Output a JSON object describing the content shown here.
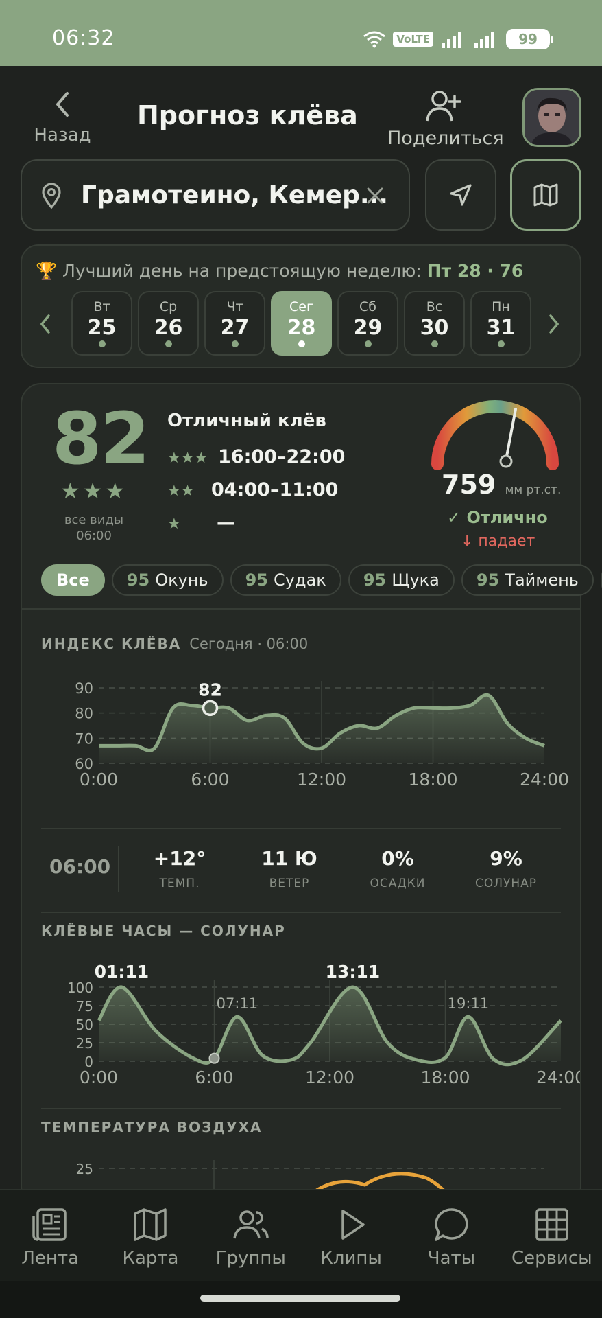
{
  "status": {
    "time": "06:32",
    "volte": "VoLTE",
    "battery": "99"
  },
  "header": {
    "back_label": "Назад",
    "title": "Прогноз клёва",
    "share_label": "Поделиться"
  },
  "search": {
    "location": "Грамотеино, Кемер..."
  },
  "best_day": {
    "prefix": "🏆 Лучший день на предстоящую неделю:",
    "value": "Пт 28 · 76"
  },
  "days": [
    {
      "wd": "Вт",
      "num": "25"
    },
    {
      "wd": "Ср",
      "num": "26"
    },
    {
      "wd": "Чт",
      "num": "27"
    },
    {
      "wd": "Сег",
      "num": "28"
    },
    {
      "wd": "Сб",
      "num": "29"
    },
    {
      "wd": "Вс",
      "num": "30"
    },
    {
      "wd": "Пн",
      "num": "31"
    }
  ],
  "selected_day_index": 3,
  "forecast": {
    "score": "82",
    "stars": "★★★",
    "species_label": "все виды",
    "time": "06:00",
    "quality": "Отличный клёв",
    "periods": [
      {
        "stars": "★★★",
        "range": "16:00–22:00"
      },
      {
        "stars": "★★",
        "range": "04:00–11:00"
      },
      {
        "stars": "★",
        "range": "—"
      }
    ],
    "pressure_value": "759",
    "pressure_unit": "мм рт.ст.",
    "pressure_status": "✓ Отлично",
    "pressure_trend": "↓ падает"
  },
  "chips": [
    {
      "score": "",
      "name": "Все",
      "active": true
    },
    {
      "score": "95",
      "name": "Окунь"
    },
    {
      "score": "95",
      "name": "Судак"
    },
    {
      "score": "95",
      "name": "Щука"
    },
    {
      "score": "95",
      "name": "Таймень"
    }
  ],
  "bite_index": {
    "title": "ИНДЕКС КЛЁВА",
    "subtitle": "Сегодня · 06:00",
    "marker_label": "82"
  },
  "weather": {
    "time": "06:00",
    "cols": [
      {
        "value": "+12°",
        "label": "ТЕМП."
      },
      {
        "value": "11 Ю",
        "label": "ВЕТЕР"
      },
      {
        "value": "0%",
        "label": "ОСАДКИ"
      },
      {
        "value": "9%",
        "label": "СОЛУНАР"
      }
    ]
  },
  "solunar": {
    "title": "КЛЁВЫЕ ЧАСЫ — СОЛУНАР",
    "labels": [
      {
        "text": "01:11",
        "major": true
      },
      {
        "text": "07:11",
        "major": false
      },
      {
        "text": "13:11",
        "major": true
      },
      {
        "text": "19:11",
        "major": false
      }
    ]
  },
  "temperature": {
    "title": "ТЕМПЕРАТУРА ВОЗДУХА"
  },
  "chart_data": [
    {
      "type": "area",
      "title": "ИНДЕКС КЛЁВА",
      "x": [
        0,
        1,
        2,
        3,
        4,
        5,
        6,
        7,
        8,
        9,
        10,
        11,
        12,
        13,
        14,
        15,
        16,
        17,
        18,
        19,
        20,
        21,
        22,
        23,
        24
      ],
      "values": [
        67,
        67,
        67,
        66,
        82,
        83,
        82,
        82,
        77,
        79,
        78,
        68,
        66,
        72,
        75,
        74,
        79,
        82,
        82,
        82,
        83,
        87,
        76,
        70,
        67
      ],
      "xticks": [
        "0:00",
        "6:00",
        "12:00",
        "18:00",
        "24:00"
      ],
      "yticks": [
        60,
        70,
        80,
        90
      ],
      "ylim": [
        60,
        90
      ],
      "xlim": [
        0,
        24
      ],
      "marker": {
        "x": 6,
        "y": 82
      }
    },
    {
      "type": "area",
      "title": "КЛЁВЫЕ ЧАСЫ — СОЛУНАР",
      "x": [
        0,
        1.19,
        3,
        5,
        6,
        7.19,
        8.5,
        10,
        11,
        13.19,
        15,
        16.5,
        18,
        19.19,
        20.5,
        22,
        24
      ],
      "values": [
        55,
        100,
        40,
        3,
        4,
        60,
        8,
        2,
        25,
        100,
        25,
        2,
        5,
        60,
        3,
        2,
        55
      ],
      "xticks": [
        "0:00",
        "6:00",
        "12:00",
        "18:00",
        "24:00"
      ],
      "yticks": [
        0,
        25,
        50,
        75,
        100
      ],
      "ylim": [
        0,
        100
      ],
      "xlim": [
        0,
        24
      ],
      "marker": {
        "x": 6,
        "y": 4
      }
    },
    {
      "type": "line",
      "title": "ТЕМПЕРАТУРА ВОЗДУХА",
      "yticks": [
        25
      ]
    }
  ],
  "nav": [
    {
      "label": "Лента",
      "icon": "feed-icon"
    },
    {
      "label": "Карта",
      "icon": "map-icon"
    },
    {
      "label": "Группы",
      "icon": "groups-icon"
    },
    {
      "label": "Клипы",
      "icon": "clips-icon"
    },
    {
      "label": "Чаты",
      "icon": "chats-icon"
    },
    {
      "label": "Сервисы",
      "icon": "services-icon"
    }
  ],
  "colors": {
    "accent": "#8aa582",
    "background": "#1f221f",
    "danger": "#e0675e"
  }
}
